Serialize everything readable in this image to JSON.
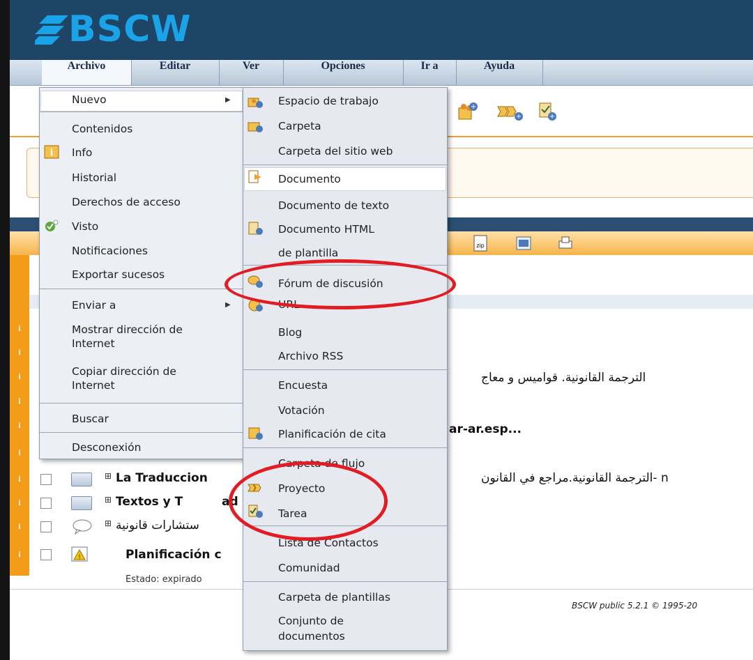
{
  "app": {
    "logo_text": "BSCW"
  },
  "menubar": {
    "items": [
      "Archivo",
      "Editar",
      "Ver",
      "Opciones",
      "Ir a",
      "Ayuda"
    ]
  },
  "archivo_menu": {
    "items": [
      "Nuevo",
      "Contenidos",
      "Info",
      "Historial",
      "Derechos de acceso",
      "Visto",
      "Notificaciones",
      "Exportar sucesos",
      "Enviar a",
      "Mostrar dirección de",
      "Internet",
      "Copiar dirección de",
      "Internet",
      "Buscar",
      "Desconexión"
    ]
  },
  "nuevo_submenu": {
    "items": [
      "Espacio de trabajo",
      "Carpeta",
      "Carpeta del sitio web",
      "Documento",
      "Documento de texto",
      "Documento HTML",
      "de plantilla",
      "Fórum de discusión",
      "URL",
      "Blog",
      "Archivo RSS",
      "Encuesta",
      "Votación",
      "Planificación de cita",
      "Carpeta de flujo",
      "Proyecto",
      "Tarea",
      "Lista de Contactos",
      "Comunidad",
      "Carpeta de plantillas",
      "Conjunto de",
      "documentos"
    ]
  },
  "list": {
    "rows": [
      {
        "text": "الترجمة القانونية. قواميس و معاج"
      },
      {
        "text": "ar-ar.esp..."
      },
      {
        "text": "La Traduccion",
        "extra": "الترجمة القانونية.مراجع في القانون- n"
      },
      {
        "text": "Textos y T",
        "extra": "ad"
      },
      {
        "text": "ستشارات قانونية"
      },
      {
        "text": "Planificación c"
      }
    ],
    "estado_label": "Estado:",
    "estado_value": "expirado"
  },
  "footer": {
    "text": "BSCW public 5.2.1 © 1995-20"
  },
  "colors": {
    "header": "#1e4466",
    "accent_orange": "#f39c1a",
    "highlight_oval": "#e31b23"
  }
}
